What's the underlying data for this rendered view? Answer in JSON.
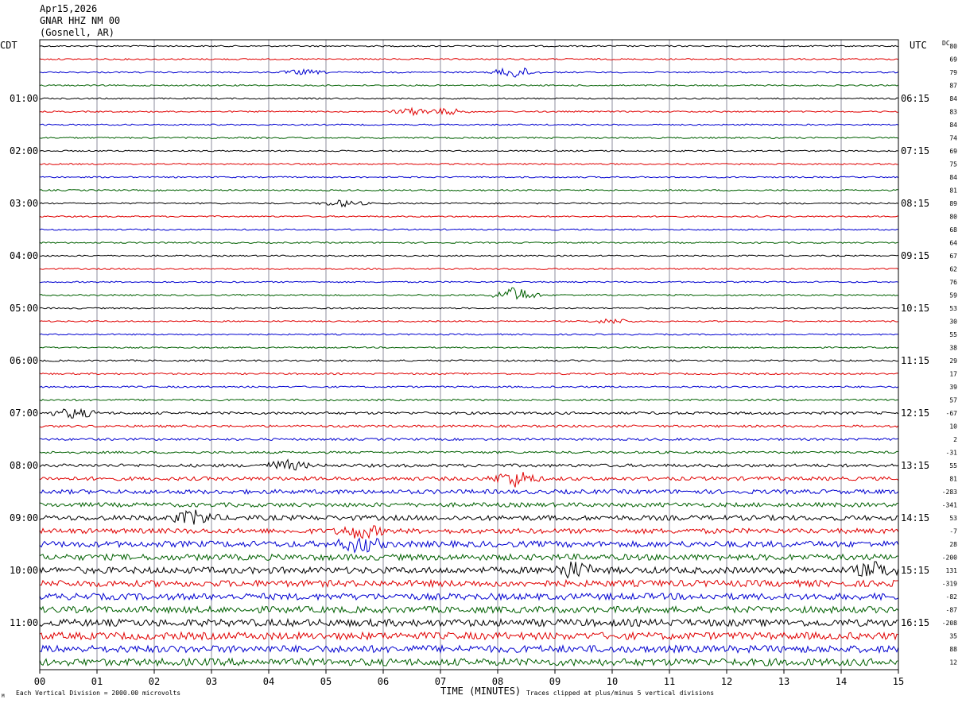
{
  "header": {
    "date": "Apr15,2026",
    "station": "GNAR HHZ NM 00",
    "location": "(Gosnell, AR)"
  },
  "labels": {
    "left_zone": "CDT",
    "right_zone": "UTC",
    "dc": "DC",
    "x_axis_title": "TIME (MINUTES)",
    "footer_left": "Each Vertical Division = 2000.00 microvolts",
    "footer_right": "Traces clipped at plus/minus 5 vertical divisions",
    "footer_mark": "M"
  },
  "colors": {
    "trace_cycle": [
      "#000000",
      "#e00000",
      "#0000d0",
      "#006000"
    ],
    "grid": "#8c8c9c",
    "frame": "#000000"
  },
  "chart_data": {
    "type": "line",
    "title": "GNAR HHZ NM 00",
    "xlabel": "TIME (MINUTES)",
    "ylabel": "",
    "xlim": [
      0,
      15
    ],
    "x_ticks": [
      "00",
      "01",
      "02",
      "03",
      "04",
      "05",
      "06",
      "07",
      "08",
      "09",
      "10",
      "11",
      "12",
      "13",
      "14",
      "15"
    ],
    "left_time_labels": [
      {
        "row": 4,
        "label": "01:00"
      },
      {
        "row": 8,
        "label": "02:00"
      },
      {
        "row": 12,
        "label": "03:00"
      },
      {
        "row": 16,
        "label": "04:00"
      },
      {
        "row": 20,
        "label": "05:00"
      },
      {
        "row": 24,
        "label": "06:00"
      },
      {
        "row": 28,
        "label": "07:00"
      },
      {
        "row": 32,
        "label": "08:00"
      },
      {
        "row": 36,
        "label": "09:00"
      },
      {
        "row": 40,
        "label": "10:00"
      },
      {
        "row": 44,
        "label": "11:00"
      }
    ],
    "right_time_labels": [
      {
        "row": 4,
        "label": "06:15"
      },
      {
        "row": 8,
        "label": "07:15"
      },
      {
        "row": 12,
        "label": "08:15"
      },
      {
        "row": 16,
        "label": "09:15"
      },
      {
        "row": 20,
        "label": "10:15"
      },
      {
        "row": 24,
        "label": "11:15"
      },
      {
        "row": 28,
        "label": "12:15"
      },
      {
        "row": 32,
        "label": "13:15"
      },
      {
        "row": 36,
        "label": "14:15"
      },
      {
        "row": 40,
        "label": "15:15"
      },
      {
        "row": 44,
        "label": "16:15"
      }
    ],
    "dc_offsets": [
      "80",
      "69",
      "79",
      "87",
      "84",
      "83",
      "84",
      "74",
      "69",
      "75",
      "84",
      "81",
      "89",
      "80",
      "68",
      "64",
      "67",
      "62",
      "76",
      "59",
      "53",
      "30",
      "55",
      "38",
      "29",
      "17",
      "39",
      "57",
      "-67",
      "10",
      "2",
      "-31",
      "55",
      "81",
      "-283",
      "-341",
      "53",
      "-7",
      "28",
      "-200",
      "131",
      "-319",
      "-82",
      "-87",
      "-208",
      "35",
      "88",
      "12"
    ],
    "row_amplitude": [
      1,
      1,
      1,
      1,
      1,
      1,
      1,
      1,
      1,
      1,
      1,
      1,
      1,
      1,
      1,
      1,
      1,
      1,
      1,
      1,
      1,
      1,
      1,
      1,
      1.2,
      1.2,
      1.2,
      1.3,
      1.8,
      1.6,
      1.6,
      1.6,
      2.2,
      2.6,
      3,
      3,
      3.5,
      3.5,
      4.2,
      4.2,
      4.5,
      4.5,
      4.5,
      4.5,
      5,
      5,
      5,
      5
    ],
    "events": [
      {
        "row": 2,
        "minute": 4.6,
        "amplitude": 3
      },
      {
        "row": 2,
        "minute": 8.3,
        "amplitude": 7
      },
      {
        "row": 5,
        "minute": 6.5,
        "amplitude": 4
      },
      {
        "row": 5,
        "minute": 7.1,
        "amplitude": 4
      },
      {
        "row": 12,
        "minute": 5.3,
        "amplitude": 4
      },
      {
        "row": 19,
        "minute": 8.3,
        "amplitude": 10
      },
      {
        "row": 21,
        "minute": 10.0,
        "amplitude": 3
      },
      {
        "row": 28,
        "minute": 0.6,
        "amplitude": 6
      },
      {
        "row": 32,
        "minute": 4.3,
        "amplitude": 6
      },
      {
        "row": 33,
        "minute": 8.3,
        "amplitude": 10
      },
      {
        "row": 36,
        "minute": 2.7,
        "amplitude": 8
      },
      {
        "row": 37,
        "minute": 5.6,
        "amplitude": 8
      },
      {
        "row": 38,
        "minute": 5.6,
        "amplitude": 9
      },
      {
        "row": 40,
        "minute": 9.3,
        "amplitude": 9
      },
      {
        "row": 40,
        "minute": 14.6,
        "amplitude": 8
      }
    ]
  }
}
